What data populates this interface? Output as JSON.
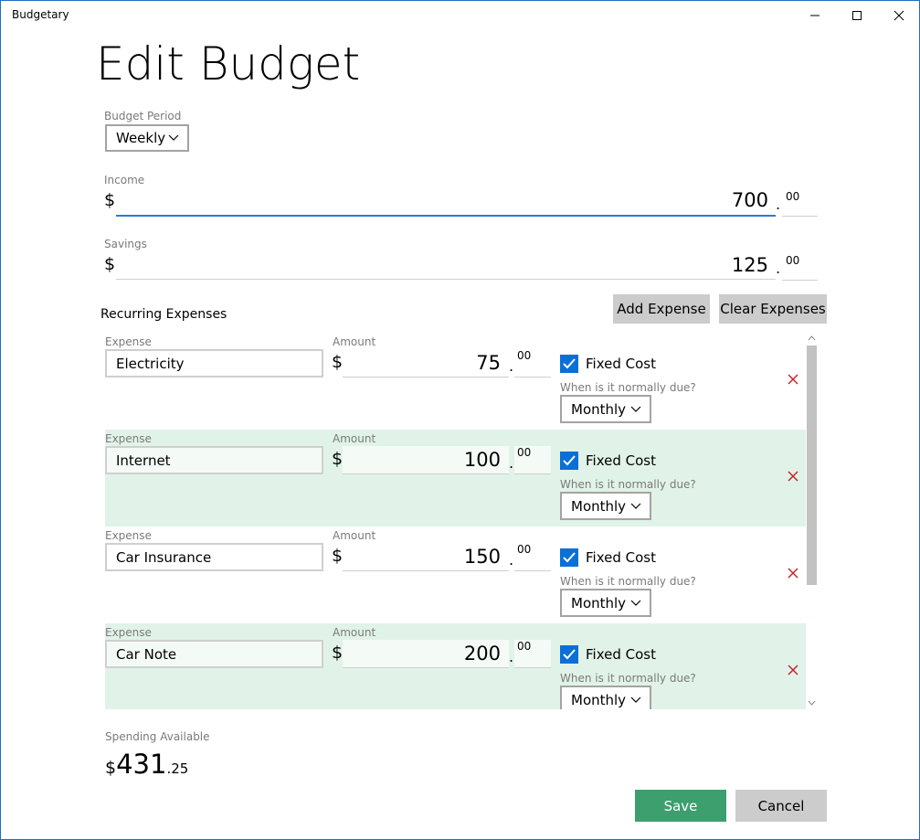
{
  "window": {
    "title": "Budgetary"
  },
  "page": {
    "heading": "Edit Budget"
  },
  "budget_period": {
    "label": "Budget Period",
    "value": "Weekly"
  },
  "income": {
    "label": "Income",
    "currency": "$",
    "amount": "700",
    "separator": ".",
    "cents": "00"
  },
  "savings": {
    "label": "Savings",
    "currency": "$",
    "amount": "125",
    "separator": ".",
    "cents": "00"
  },
  "recurring": {
    "title": "Recurring Expenses",
    "add_label": "Add Expense",
    "clear_label": "Clear Expenses",
    "expense_label": "Expense",
    "amount_label": "Amount",
    "fixed_label": "Fixed Cost",
    "due_label": "When is it normally due?",
    "currency": "$",
    "separator": ".",
    "items": [
      {
        "name": "Electricity",
        "amount": "75",
        "cents": "00",
        "fixed": true,
        "due": "Monthly"
      },
      {
        "name": "Internet",
        "amount": "100",
        "cents": "00",
        "fixed": true,
        "due": "Monthly"
      },
      {
        "name": "Car Insurance",
        "amount": "150",
        "cents": "00",
        "fixed": true,
        "due": "Monthly"
      },
      {
        "name": "Car Note",
        "amount": "200",
        "cents": "00",
        "fixed": true,
        "due": "Monthly"
      }
    ]
  },
  "spending": {
    "label": "Spending Available",
    "currency": "$",
    "amount": "431",
    "cents": ".25"
  },
  "actions": {
    "save_label": "Save",
    "cancel_label": "Cancel"
  },
  "colors": {
    "accent": "#0a6fd8",
    "save": "#3d9f6d",
    "row_alt": "#e1f3e8",
    "delete": "#c0272d"
  }
}
